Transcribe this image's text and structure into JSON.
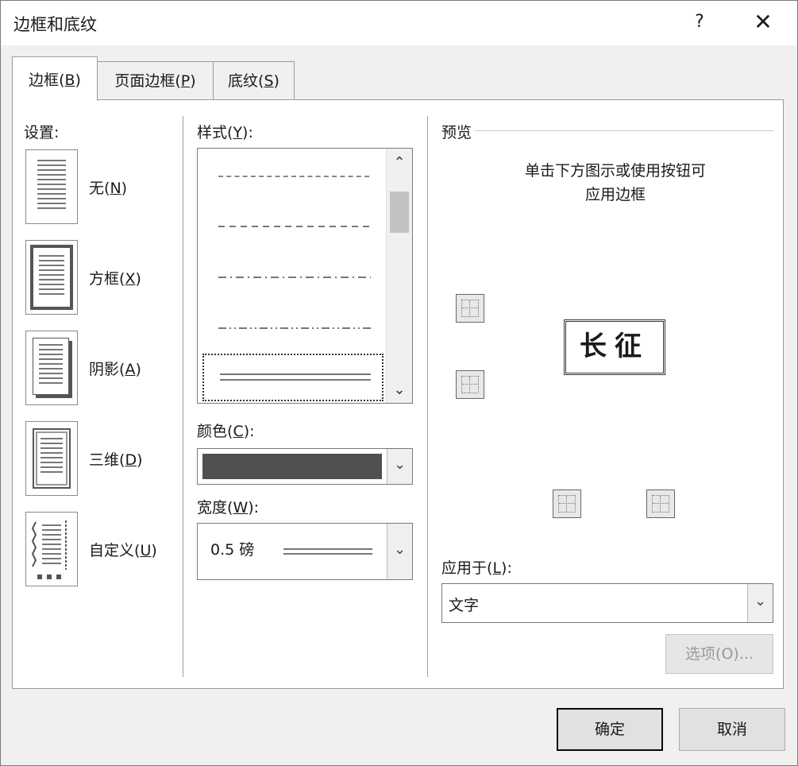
{
  "window": {
    "title": "边框和底纹",
    "help_glyph": "?",
    "close_glyph": "✕"
  },
  "tabs": [
    {
      "label": "边框",
      "key": "B",
      "active": true
    },
    {
      "label": "页面边框",
      "key": "P",
      "active": false
    },
    {
      "label": "底纹",
      "key": "S",
      "active": false
    }
  ],
  "setting": {
    "heading": "设置:",
    "options": [
      {
        "label": "无",
        "key": "N"
      },
      {
        "label": "方框",
        "key": "X"
      },
      {
        "label": "阴影",
        "key": "A"
      },
      {
        "label": "三维",
        "key": "D"
      },
      {
        "label": "自定义",
        "key": "U"
      }
    ]
  },
  "style": {
    "heading": "样式",
    "key": "Y"
  },
  "color": {
    "heading": "颜色",
    "key": "C",
    "value_color": "#505050"
  },
  "width": {
    "heading": "宽度",
    "key": "W",
    "value": "0.5 磅"
  },
  "preview": {
    "heading": "预览",
    "hint_line1": "单击下方图示或使用按钮可",
    "hint_line2": "应用边框",
    "sample_text": "长征"
  },
  "apply_to": {
    "heading": "应用于",
    "key": "L",
    "value": "文字"
  },
  "buttons": {
    "options": "选项(O)...",
    "ok": "确定",
    "cancel": "取消"
  },
  "icons": {
    "scroll_up": "⌃",
    "scroll_down": "⌄",
    "dropdown": "⌄"
  }
}
